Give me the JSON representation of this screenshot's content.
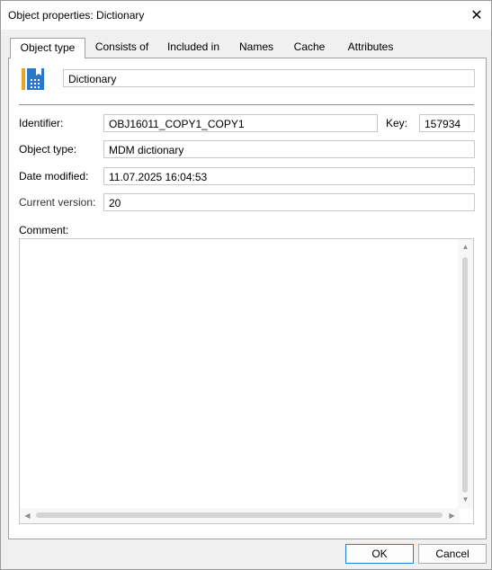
{
  "window": {
    "title": "Object properties: Dictionary"
  },
  "tabs": [
    {
      "label": "Object type"
    },
    {
      "label": "Consists of"
    },
    {
      "label": "Included in"
    },
    {
      "label": "Names"
    },
    {
      "label": "Cache"
    },
    {
      "label": "Attributes"
    }
  ],
  "header": {
    "icon": "dictionary-icon",
    "icon_colors": {
      "bar": "#f0a020",
      "book": "#2a78c8"
    },
    "name_value": "Dictionary"
  },
  "form": {
    "identifier_label": "Identifier:",
    "identifier_value": "OBJ16011_COPY1_COPY1",
    "key_label": "Key:",
    "key_value": "157934",
    "object_type_label": "Object type:",
    "object_type_value": "MDM dictionary",
    "date_modified_label": "Date modified:",
    "date_modified_value": "11.07.2025 16:04:53",
    "current_version_label": "Current version:",
    "current_version_value": "20",
    "comment_label": "Comment:",
    "comment_value": ""
  },
  "buttons": {
    "ok": "OK",
    "cancel": "Cancel"
  }
}
